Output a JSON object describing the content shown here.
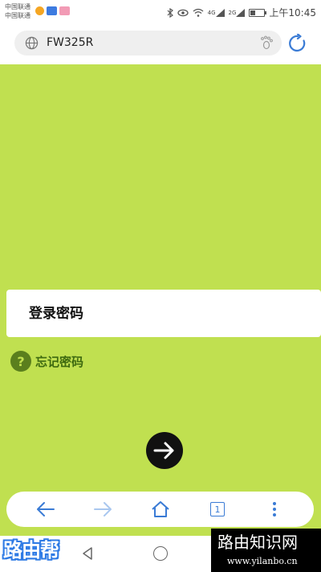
{
  "status_bar": {
    "carrier_line1": "中国联通",
    "carrier_line2": "中国联通",
    "network_1": "4G",
    "network_2": "2G",
    "battery_level": 0.35,
    "time": "上午10:45"
  },
  "address_bar": {
    "url": "FW325R"
  },
  "login": {
    "password_label": "登录密码",
    "forgot_password": "忘记密码"
  },
  "bottom_nav": {
    "tab_count": "1"
  },
  "watermark": {
    "left_logo": "路由帮",
    "right_title": "路由知识网",
    "right_url": "www.yilanbo.cn"
  },
  "colors": {
    "page_background": "#c0e050",
    "accent_blue": "#3a7bd5",
    "help_icon": "#5a7f1d"
  }
}
